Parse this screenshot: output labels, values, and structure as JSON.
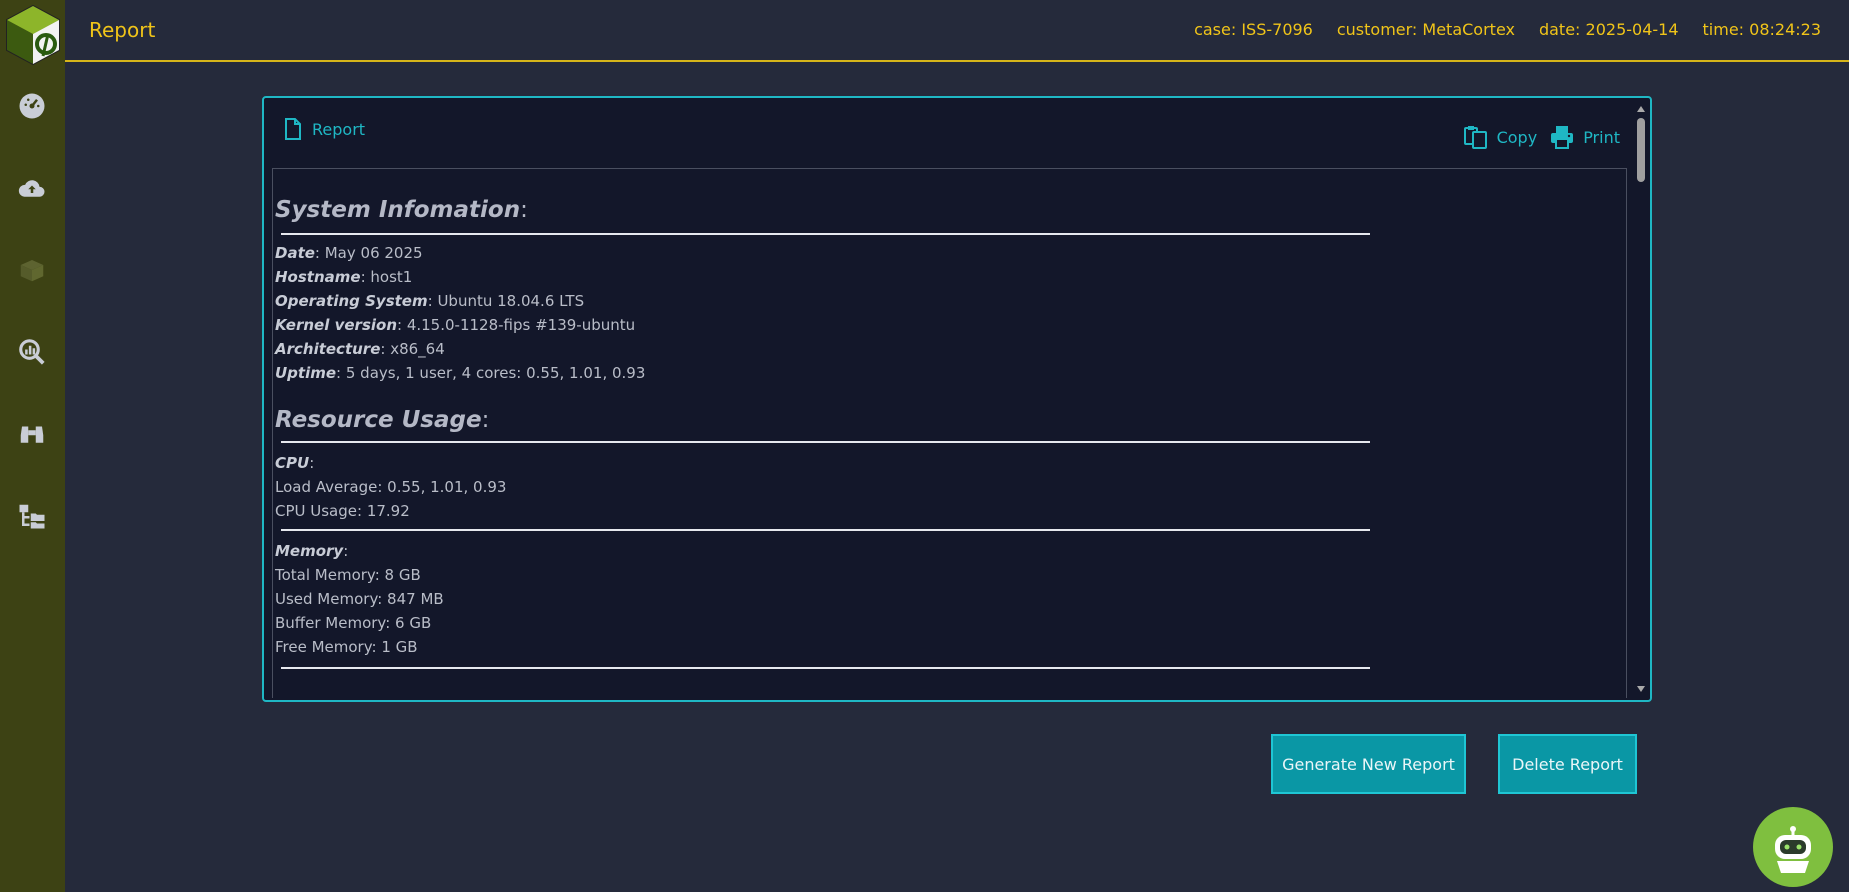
{
  "header": {
    "title": "Report",
    "case": "case: ISS-7096",
    "customer": "customer: MetaCortex",
    "date": "date: 2025-04-14",
    "time": "time: 08:24:23"
  },
  "sidebar": {
    "items": [
      {
        "name": "dashboard",
        "icon": "gauge-icon"
      },
      {
        "name": "upload",
        "icon": "cloud-upload-icon"
      },
      {
        "name": "packages",
        "icon": "box-icon"
      },
      {
        "name": "analysis",
        "icon": "chart-search-icon"
      },
      {
        "name": "investigate",
        "icon": "binoculars-icon"
      },
      {
        "name": "files",
        "icon": "folder-tree-icon"
      }
    ]
  },
  "panel": {
    "title": "Report",
    "copy_label": "Copy",
    "print_label": "Print"
  },
  "report": {
    "system_heading": "System Infomation",
    "system": [
      {
        "key": "Date",
        "value": ": May 06 2025"
      },
      {
        "key": "Hostname",
        "value": ": host1"
      },
      {
        "key": "Operating System",
        "value": ": Ubuntu 18.04.6 LTS"
      },
      {
        "key": "Kernel version",
        "value": ": 4.15.0-1128-fips #139-ubuntu"
      },
      {
        "key": "Architecture",
        "value": ": x86_64"
      },
      {
        "key": "Uptime",
        "value": ": 5 days, 1 user, 4 cores: 0.55, 1.01, 0.93"
      }
    ],
    "resource_heading": "Resource Usage",
    "cpu_label": "CPU",
    "cpu_lines": [
      "Load Average: 0.55, 1.01, 0.93",
      "CPU Usage: 17.92"
    ],
    "memory_label": "Memory",
    "memory_lines": [
      "Total Memory: 8 GB",
      "Used Memory: 847 MB",
      "Buffer Memory: 6 GB",
      "Free Memory: 1 GB"
    ]
  },
  "buttons": {
    "generate": "Generate New Report",
    "delete": "Delete Report"
  },
  "colors": {
    "accent": "#1fb7c4",
    "header_text": "#f0c419",
    "sidebar_bg": "#3d4214",
    "button_bg": "#0a97a5"
  }
}
